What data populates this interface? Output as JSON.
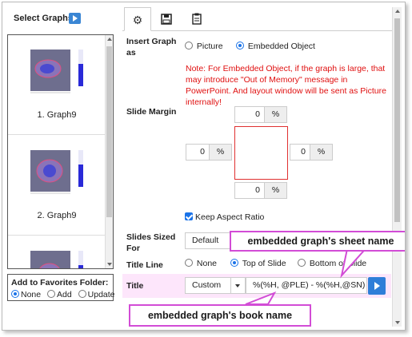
{
  "left": {
    "header": "Select Graphs",
    "thumbnails": [
      {
        "caption": "1. Graph9"
      },
      {
        "caption": "2. Graph9"
      },
      {
        "caption": ""
      }
    ],
    "favorites": {
      "title": "Add to Favorites Folder:",
      "options": [
        "None",
        "Add",
        "Update"
      ],
      "selected": "None"
    }
  },
  "tabs": [
    {
      "icon": "gear-icon",
      "active": true
    },
    {
      "icon": "save-icon",
      "active": false
    },
    {
      "icon": "clipboard-icon",
      "active": false
    }
  ],
  "form": {
    "insert_graph_label": "Insert Graph as",
    "insert_options": [
      "Picture",
      "Embedded Object"
    ],
    "insert_selected": "Embedded Object",
    "note": "Note: For Embedded Object, if the graph is large, that may introduce \"Out of Memory\" message in PowerPoint. And layout window will be sent as Picture internally!",
    "slide_margin_label": "Slide Margin",
    "margins": {
      "top": "0",
      "left": "0",
      "right": "0",
      "bottom": "0",
      "unit": "%"
    },
    "keep_aspect_label": "Keep Aspect Ratio",
    "slides_sized_label": "Slides Sized For",
    "slides_sized_value": "Default",
    "title_line_label": "Title Line",
    "title_line_options": [
      "None",
      "Top of Slide",
      "Bottom of Slide"
    ],
    "title_line_selected": "Top of Slide",
    "title_label": "Title",
    "title_mode": "Custom",
    "title_value": "%(%H, @PLE) - %(%H,@SN)"
  },
  "callouts": {
    "sheet": "embedded graph's sheet name",
    "book": "embedded graph's book name"
  },
  "colors": {
    "callout_border": "#d24cd6",
    "title_row_bg": "#fde6fb",
    "note": "#e01010"
  }
}
